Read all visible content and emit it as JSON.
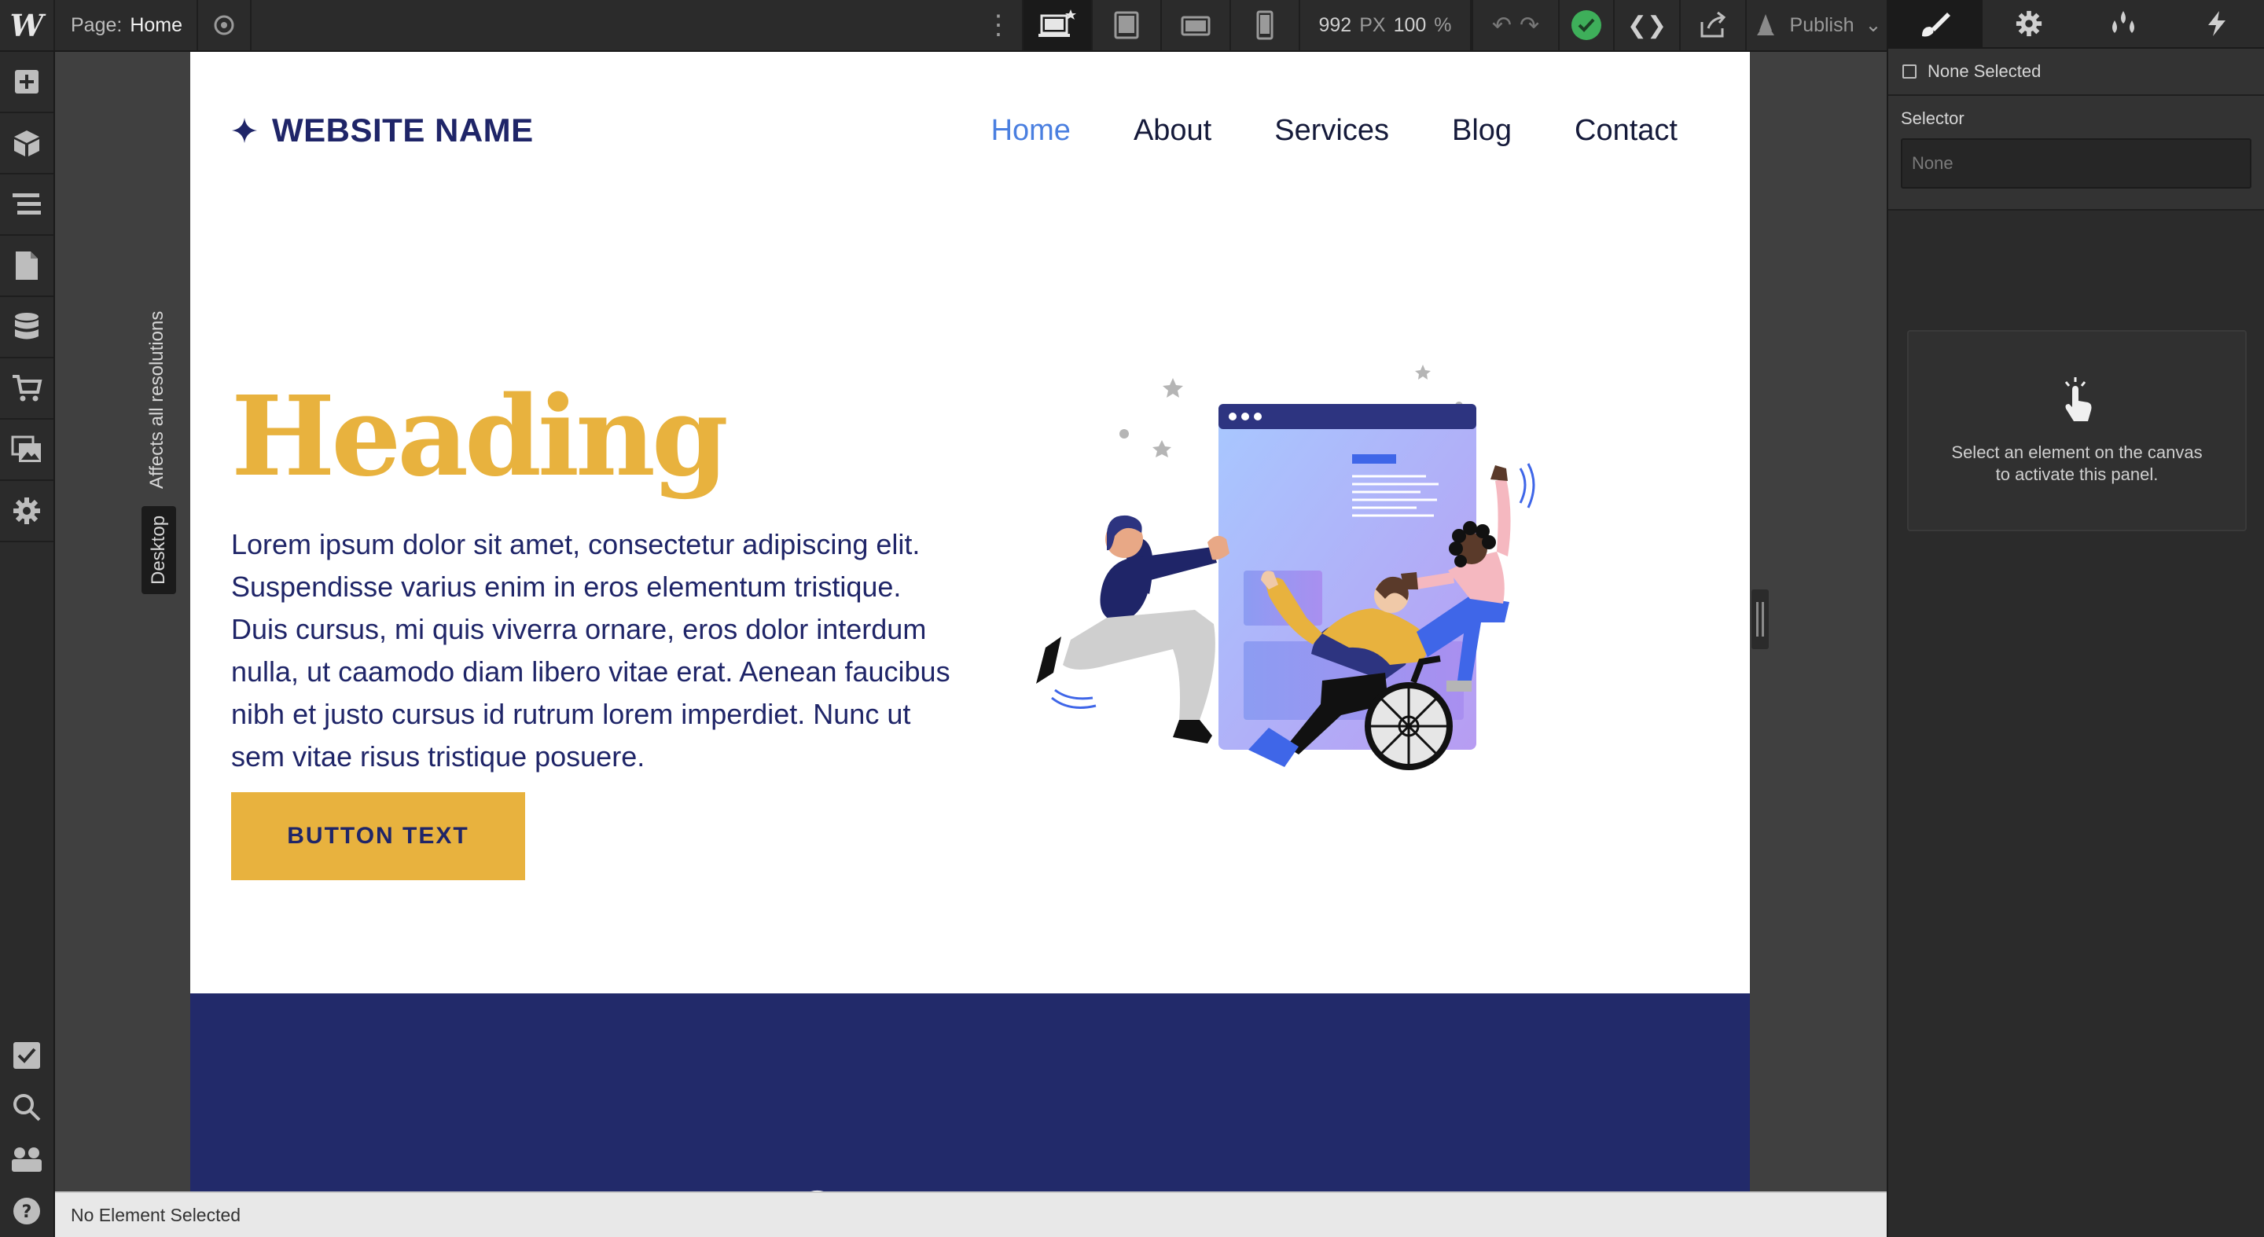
{
  "topbar": {
    "logo": "W",
    "page_label": "Page:",
    "page_name": "Home",
    "width_value": "992",
    "width_unit": "PX",
    "zoom_value": "100",
    "zoom_unit": "%",
    "publish_label": "Publish"
  },
  "leftbar": {
    "items": [
      "add-icon",
      "components-icon",
      "navigator-icon",
      "pages-icon",
      "cms-icon",
      "ecommerce-icon",
      "assets-icon",
      "settings-icon"
    ],
    "bottom_items": [
      "audit-icon",
      "search-icon",
      "collaborators-icon",
      "help-icon"
    ]
  },
  "canvas": {
    "breakpoint_note": "Affects all resolutions",
    "breakpoint_name": "Desktop"
  },
  "site": {
    "brand": "WEBSITE NAME",
    "nav": [
      "Home",
      "About",
      "Services",
      "Blog",
      "Contact"
    ],
    "active_nav": "Home",
    "heading": "Heading",
    "body": "Lorem ipsum dolor sit amet, consectetur adipiscing elit. Suspendisse varius enim in eros elementum tristique. Duis cursus, mi quis viverra ornare, eros dolor interdum nulla, ut caamodo diam libero vitae erat. Aenean faucibus nibh et justo cursus id rutrum lorem imperdiet. Nunc ut sem vitae risus tristique posuere.",
    "button": "BUTTON TEXT",
    "colors": {
      "brand": "#1f2568",
      "accent": "#e8b23e",
      "link_active": "#4a7fe0",
      "band": "#222a6a"
    }
  },
  "statusbar": {
    "text": "No Element Selected"
  },
  "rpanel": {
    "tabs": [
      "style-brush-icon",
      "settings-gear-icon",
      "interactions-drops-icon",
      "lightning-icon"
    ],
    "none_selected": "None Selected",
    "selector_label": "Selector",
    "selector_placeholder": "None",
    "empty_message": "Select an element on the canvas to activate this panel."
  }
}
